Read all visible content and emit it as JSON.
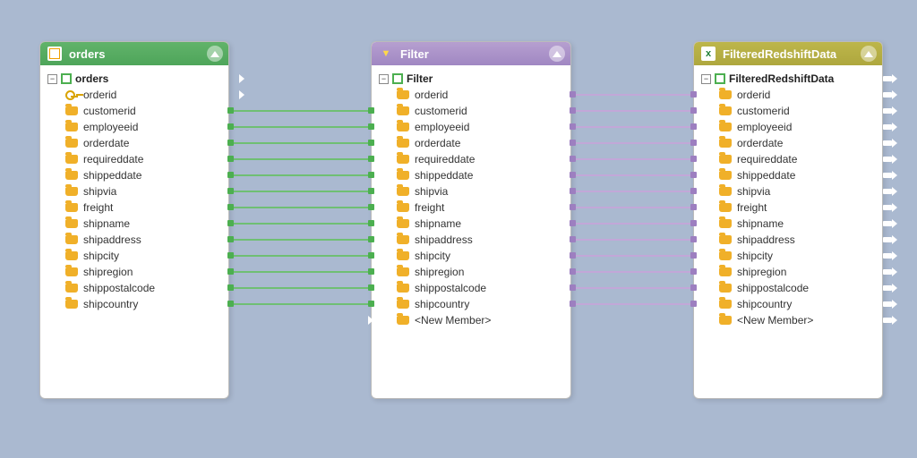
{
  "nodes": {
    "orders": {
      "title": "orders",
      "root_label": "orders",
      "fields": [
        {
          "name": "orderid",
          "icon": "key"
        },
        {
          "name": "customerid",
          "icon": "folder"
        },
        {
          "name": "employeeid",
          "icon": "folder"
        },
        {
          "name": "orderdate",
          "icon": "folder"
        },
        {
          "name": "requireddate",
          "icon": "folder"
        },
        {
          "name": "shippeddate",
          "icon": "folder"
        },
        {
          "name": "shipvia",
          "icon": "folder"
        },
        {
          "name": "freight",
          "icon": "folder"
        },
        {
          "name": "shipname",
          "icon": "folder"
        },
        {
          "name": "shipaddress",
          "icon": "folder"
        },
        {
          "name": "shipcity",
          "icon": "folder"
        },
        {
          "name": "shipregion",
          "icon": "folder"
        },
        {
          "name": "shippostalcode",
          "icon": "folder"
        },
        {
          "name": "shipcountry",
          "icon": "folder"
        }
      ]
    },
    "filter": {
      "title": "Filter",
      "root_label": "Filter",
      "fields": [
        {
          "name": "orderid",
          "icon": "folder"
        },
        {
          "name": "customerid",
          "icon": "folder"
        },
        {
          "name": "employeeid",
          "icon": "folder"
        },
        {
          "name": "orderdate",
          "icon": "folder"
        },
        {
          "name": "requireddate",
          "icon": "folder"
        },
        {
          "name": "shippeddate",
          "icon": "folder"
        },
        {
          "name": "shipvia",
          "icon": "folder"
        },
        {
          "name": "freight",
          "icon": "folder"
        },
        {
          "name": "shipname",
          "icon": "folder"
        },
        {
          "name": "shipaddress",
          "icon": "folder"
        },
        {
          "name": "shipcity",
          "icon": "folder"
        },
        {
          "name": "shipregion",
          "icon": "folder"
        },
        {
          "name": "shippostalcode",
          "icon": "folder"
        },
        {
          "name": "shipcountry",
          "icon": "folder"
        }
      ],
      "new_member": "<New Member>"
    },
    "redshift": {
      "title": "FilteredRedshiftData",
      "root_label": "FilteredRedshiftData",
      "fields": [
        {
          "name": "orderid",
          "icon": "folder"
        },
        {
          "name": "customerid",
          "icon": "folder"
        },
        {
          "name": "employeeid",
          "icon": "folder"
        },
        {
          "name": "orderdate",
          "icon": "folder"
        },
        {
          "name": "requireddate",
          "icon": "folder"
        },
        {
          "name": "shippeddate",
          "icon": "folder"
        },
        {
          "name": "shipvia",
          "icon": "folder"
        },
        {
          "name": "freight",
          "icon": "folder"
        },
        {
          "name": "shipname",
          "icon": "folder"
        },
        {
          "name": "shipaddress",
          "icon": "folder"
        },
        {
          "name": "shipcity",
          "icon": "folder"
        },
        {
          "name": "shipregion",
          "icon": "folder"
        },
        {
          "name": "shippostalcode",
          "icon": "folder"
        },
        {
          "name": "shipcountry",
          "icon": "folder"
        }
      ],
      "new_member": "<New Member>"
    }
  },
  "expander_symbol": "−"
}
